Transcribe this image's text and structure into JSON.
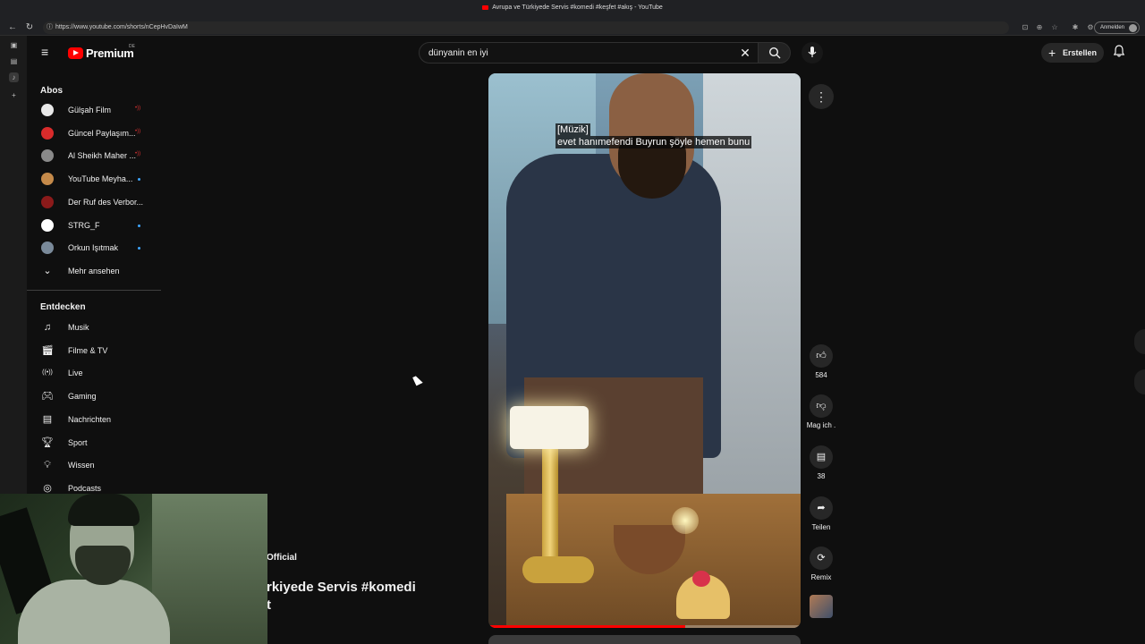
{
  "browser": {
    "tab_title": "Avrupa ve Türkiyede Servis #komedi #keşfet #akış - YouTube",
    "url": "https://www.youtube.com/shorts/nCepHvDaIwM",
    "signin_label": "Anmelden"
  },
  "header": {
    "logo_text": "Premium",
    "country_code": "DE",
    "search_value": "dünyanin en iyi",
    "create_label": "Erstellen"
  },
  "sidebar": {
    "subscriptions_title": "Abos",
    "subscriptions": [
      {
        "label": "Gülşah Film",
        "color": "#e8e8e8",
        "indicator": "live"
      },
      {
        "label": "Güncel Paylaşım...",
        "color": "#d92b2b",
        "indicator": "live"
      },
      {
        "label": "Al Sheikh Maher ...",
        "color": "#8a8a8a",
        "indicator": "live"
      },
      {
        "label": "YouTube Meyha...",
        "color": "#c58a4a",
        "indicator": "dot"
      },
      {
        "label": "Der Ruf des Verbor...",
        "color": "#8b1a1a",
        "indicator": "none"
      },
      {
        "label": "STRG_F",
        "color": "#ffffff",
        "indicator": "dot"
      },
      {
        "label": "Orkun Işıtmak",
        "color": "#7a8a9a",
        "indicator": "dot"
      }
    ],
    "show_more_label": "Mehr ansehen",
    "explore_title": "Entdecken",
    "explore": [
      {
        "label": "Musik",
        "icon": "music-note-icon"
      },
      {
        "label": "Filme & TV",
        "icon": "clapperboard-icon"
      },
      {
        "label": "Live",
        "icon": "live-broadcast-icon"
      },
      {
        "label": "Gaming",
        "icon": "gamepad-icon"
      },
      {
        "label": "Nachrichten",
        "icon": "newspaper-icon"
      },
      {
        "label": "Sport",
        "icon": "trophy-icon"
      },
      {
        "label": "Wissen",
        "icon": "lightbulb-icon"
      },
      {
        "label": "Podcasts",
        "icon": "podcast-icon"
      }
    ]
  },
  "short": {
    "caption_line1": "[Müzik]",
    "caption_line2": "evet hanımefendi Buyrun şöyle hemen bunu",
    "progress": 0.63,
    "like_count": "584",
    "dislike_label": "Mag ich .",
    "comment_count": "38",
    "share_label": "Teilen",
    "remix_label": "Remix",
    "channel_partial": "Official",
    "title_line1": "rkiyede Servis #komedi",
    "title_line2": "t"
  },
  "colors": {
    "brand_red": "#ff0000",
    "accent_blue": "#3ea6ff",
    "background": "#0f0f0f"
  }
}
